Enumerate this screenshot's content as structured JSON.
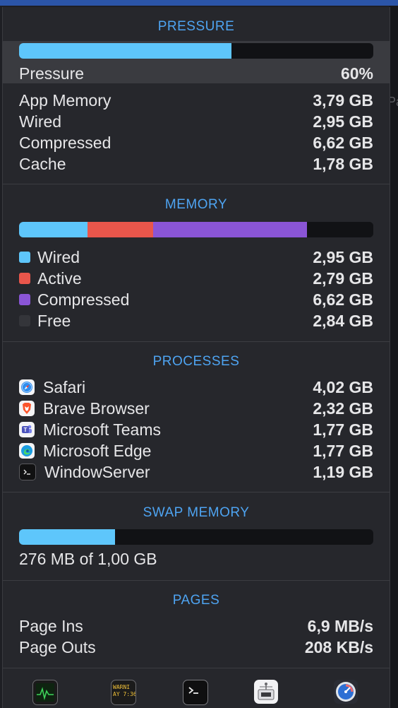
{
  "colors": {
    "accent": "#4ea4f2",
    "wired": "#5ec6fb",
    "active": "#e9564b",
    "compressed": "#8a55d6",
    "free": "#111215",
    "swap": "#5ec6fb"
  },
  "pressure": {
    "title": "PRESSURE",
    "label": "Pressure",
    "value": "60%",
    "fraction": 0.6,
    "details": [
      {
        "label": "App Memory",
        "value": "3,79 GB"
      },
      {
        "label": "Wired",
        "value": "2,95 GB"
      },
      {
        "label": "Compressed",
        "value": "6,62 GB"
      },
      {
        "label": "Cache",
        "value": "1,78 GB"
      }
    ]
  },
  "memory": {
    "title": "MEMORY",
    "segments": [
      {
        "label": "Wired",
        "value": "2,95 GB",
        "gb": 2.95,
        "color": "#5ec6fb"
      },
      {
        "label": "Active",
        "value": "2,79 GB",
        "gb": 2.79,
        "color": "#e9564b"
      },
      {
        "label": "Compressed",
        "value": "6,62 GB",
        "gb": 6.62,
        "color": "#8a55d6"
      },
      {
        "label": "Free",
        "value": "2,84 GB",
        "gb": 2.84,
        "color": "#111215"
      }
    ]
  },
  "processes": {
    "title": "PROCESSES",
    "items": [
      {
        "name": "Safari",
        "value": "4,02 GB",
        "icon": "safari-icon"
      },
      {
        "name": "Brave Browser",
        "value": "2,32 GB",
        "icon": "brave-icon"
      },
      {
        "name": "Microsoft Teams",
        "value": "1,77 GB",
        "icon": "teams-icon"
      },
      {
        "name": "Microsoft Edge",
        "value": "1,77 GB",
        "icon": "edge-icon"
      },
      {
        "name": "WindowServer",
        "value": "1,19 GB",
        "icon": "terminal-icon"
      }
    ]
  },
  "swap": {
    "title": "SWAP MEMORY",
    "text": "276 MB of 1,00 GB",
    "fraction": 0.27
  },
  "pages": {
    "title": "PAGES",
    "rows": [
      {
        "label": "Page Ins",
        "value": "6,9 MB/s"
      },
      {
        "label": "Page Outs",
        "value": "208 KB/s"
      }
    ]
  },
  "dock": {
    "icons": [
      "activity-monitor-icon",
      "console-icon",
      "terminal-icon",
      "system-information-icon",
      "disk-utility-icon"
    ],
    "console_text": "WARNI\nAY 7:36"
  }
}
